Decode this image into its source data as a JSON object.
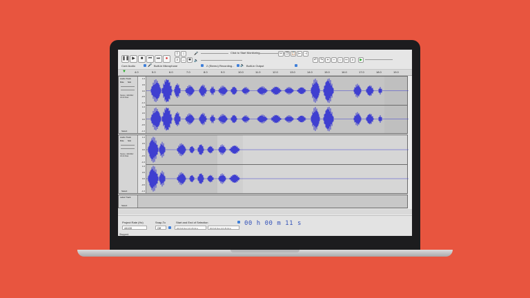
{
  "toolbar": {
    "transport": [
      "pause",
      "play",
      "stop",
      "skip-start",
      "skip-end",
      "record"
    ],
    "monitor_text": "Click to Start Monitoring",
    "host": "Core Audio",
    "input_device": "Built-in Microphone",
    "channels": "2 (Stereo) Recording...",
    "output_device": "Built-in Output"
  },
  "ruler": {
    "ticks": [
      "4.0",
      "5.0",
      "6.0",
      "7.0",
      "8.0",
      "9.0",
      "10.0",
      "11.0",
      "12.0",
      "13.0",
      "14.0",
      "15.0",
      "16.0",
      "17.0",
      "18.0",
      "19.0"
    ]
  },
  "tracks": [
    {
      "name": "Audio Track",
      "info": "Stereo, 44100Hz\n32-bit float",
      "mute": "Mute",
      "solo": "Solo",
      "select": "Select",
      "scale": [
        "1.0",
        "0.5",
        "0.0",
        "-0.5",
        "-1.0"
      ]
    },
    {
      "name": "Audio Track",
      "info": "Stereo, 44100Hz\n32-bit float",
      "mute": "Mute",
      "solo": "Solo",
      "select": "Select",
      "scale": [
        "1.0",
        "0.5",
        "0.0",
        "-0.5",
        "-1.0"
      ]
    },
    {
      "name": "Label Track",
      "select": "Select"
    }
  ],
  "bottom": {
    "rate_label": "Project Rate (Hz)",
    "rate_value": "44100",
    "snap_label": "Snap-To",
    "snap_value": "Off",
    "selection_label": "Start and End of Selection",
    "sel_start": "0 0 h 0 0 m 1 0 .8 3 2 s",
    "sel_end": "0 0 h 0 0 m 1 0 .8 3 2 s",
    "time": "00 h 00 m 11 s",
    "status": "Stopped."
  },
  "colors": {
    "background": "#e8553f",
    "waveform": "#3f3fd0",
    "time_text": "#3452b8"
  }
}
